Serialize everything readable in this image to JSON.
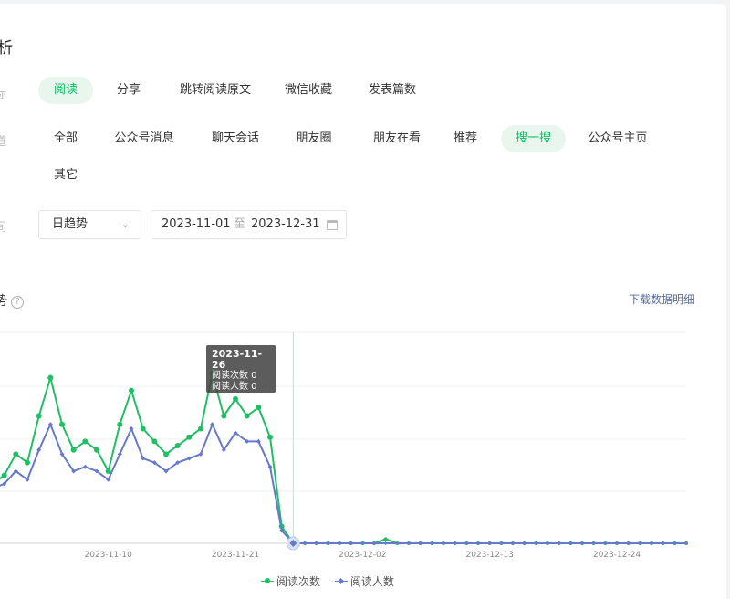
{
  "section": {
    "title": "分析"
  },
  "filters": {
    "metric": {
      "label": "标",
      "chips": [
        {
          "label": "阅读",
          "active": true
        },
        {
          "label": "分享",
          "active": false
        },
        {
          "label": "跳转阅读原文",
          "active": false
        },
        {
          "label": "微信收藏",
          "active": false
        },
        {
          "label": "发表篇数",
          "active": false
        }
      ]
    },
    "channel": {
      "label": "道",
      "chips": [
        {
          "label": "全部",
          "active": false
        },
        {
          "label": "公众号消息",
          "active": false
        },
        {
          "label": "聊天会话",
          "active": false
        },
        {
          "label": "朋友圈",
          "active": false
        },
        {
          "label": "朋友在看",
          "active": false
        },
        {
          "label": "推荐",
          "active": false
        },
        {
          "label": "搜一搜",
          "active": true
        },
        {
          "label": "公众号主页",
          "active": false
        },
        {
          "label": "其它",
          "active": false
        }
      ]
    },
    "time": {
      "label": "间",
      "granularity": "日趋势",
      "start_date": "2023-11-01",
      "separator": "至",
      "end_date": "2023-12-31"
    }
  },
  "trend": {
    "title": "趋势",
    "help_glyph": "?",
    "download_label": "下载数据明细"
  },
  "tooltip": {
    "date": "2023-11-26",
    "lines": [
      "阅读次数 0",
      "阅读人数 0"
    ]
  },
  "colors": {
    "accent": "#07c160",
    "series_reads": "#1fbf63",
    "series_readers": "#6779c9",
    "link": "#576b95"
  },
  "chart_data": {
    "type": "line",
    "x_tick_labels": [
      "2023-11-10",
      "2023-11-21",
      "2023-12-02",
      "2023-12-13",
      "2023-12-24"
    ],
    "x_start": "2023-10-31",
    "x_end": "2023-12-31",
    "grid": true,
    "legend_position": "bottom",
    "series": [
      {
        "name": "阅读次数",
        "color": "#1fbf63",
        "marker": "circle",
        "values": [
          14,
          16,
          21,
          19,
          30,
          39,
          28,
          22,
          24,
          22,
          17,
          28,
          36,
          27,
          24,
          21,
          23,
          25,
          27,
          40,
          30,
          34,
          30,
          32,
          25,
          4,
          0,
          0,
          0,
          0,
          0,
          0,
          0,
          0,
          1,
          0,
          0,
          0,
          0,
          0,
          0,
          0,
          0,
          0,
          0,
          0,
          0,
          0,
          0,
          0,
          0,
          0,
          0,
          0,
          0,
          0,
          0,
          0,
          0,
          0,
          0
        ]
      },
      {
        "name": "阅读人数",
        "color": "#6779c9",
        "marker": "diamond",
        "values": [
          13,
          14,
          17,
          15,
          22,
          28,
          21,
          17,
          18,
          17,
          15,
          21,
          27,
          20,
          19,
          17,
          19,
          20,
          21,
          28,
          22,
          26,
          24,
          24,
          18,
          3,
          0,
          0,
          0,
          0,
          0,
          0,
          0,
          0,
          0,
          0,
          0,
          0,
          0,
          0,
          0,
          0,
          0,
          0,
          0,
          0,
          0,
          0,
          0,
          0,
          0,
          0,
          0,
          0,
          0,
          0,
          0,
          0,
          0,
          0,
          0
        ]
      }
    ]
  }
}
